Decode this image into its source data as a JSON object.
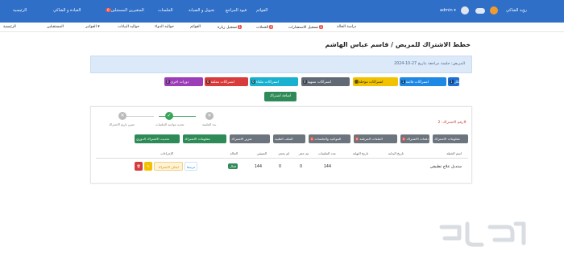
{
  "topbar": {
    "home": "الرئيسية",
    "clinic": "العيادة و الشاكي",
    "doctors": "المتغيرين المسجلين",
    "sessions": "الجلسات",
    "doctors_badge": "0",
    "followup": "تحويل و الصيانة",
    "employees": "قيود المراجع",
    "reports": "القوائم",
    "admin": "admin",
    "user_name": "رؤية الشاكي"
  },
  "subnav": {
    "items": [
      "الرئيسية",
      "المستقبلين",
      "الفواتير",
      "حواليه البيانات",
      "حواليه الدواء",
      "القوائم",
      "تسجيل زيارة",
      "الحملات",
      "تسجيل الاستشارات",
      "دراسة الحالة"
    ],
    "badges": [
      "1",
      "4",
      "1"
    ]
  },
  "page": {
    "title": "خطط الاشتراك للمريض / قاسم عباس الهاشم",
    "alert": "المريض: جلسة مراجعة بتاريخ 27-10-2024"
  },
  "chips": [
    {
      "label": "الكل",
      "n": "1",
      "color": "#1d6fd1"
    },
    {
      "label": "اشتراكات قائمة",
      "n": "1",
      "color": "#1e88e5"
    },
    {
      "label": "اشتراكات مؤجلة",
      "n": "0",
      "color": "#f2c200"
    },
    {
      "label": "اشتراكات منتهية",
      "n": "0",
      "color": "#616975"
    },
    {
      "label": "اشتراكات ملغاة",
      "n": "0",
      "color": "#18b1cf"
    },
    {
      "label": "اشتراكات معلقة",
      "n": "0",
      "color": "#d73b3b"
    },
    {
      "label": "دورات اخرى",
      "n": "0",
      "color": "#9c3eb7"
    }
  ],
  "add_button": "اضافة اشتراك",
  "card": {
    "title": "رقم الاشتراك: 2#",
    "steps": [
      {
        "label": "تعيين تاريخ الاشتراك"
      },
      {
        "label": "تحديد مواعيد الجلسات"
      },
      {
        "label": "بدء الجلسة"
      }
    ],
    "tabs": [
      {
        "label": "تحديث الاشتراك الدوري",
        "n": ""
      },
      {
        "label": "معلومات الاشتراك",
        "n": "",
        "green": true
      },
      {
        "label": "تقرير الاشتراك",
        "n": ""
      },
      {
        "label": "الملف الطبية",
        "n": ""
      },
      {
        "label": "المواعيد والجلسات",
        "n": "0"
      },
      {
        "label": "الملفات المرفقة",
        "n": "0"
      },
      {
        "label": "دفعات الاشتراك",
        "n": "0"
      },
      {
        "label": "معلومات الاشتراك",
        "n": ""
      }
    ],
    "headers": [
      "اسم الخطة",
      "تاريخ البداية",
      "تاريخ النهاية",
      "عدد الجلسات",
      "تم حجز",
      "لم يحجز",
      "المتبقي",
      "الحالة",
      "الإجراءات"
    ],
    "row": {
      "plan": "ستديل علاج تطبيقي",
      "start": "",
      "end": "",
      "sessions": "144",
      "booked": "0",
      "not_booked": "0",
      "remaining": "144",
      "status": "فعال",
      "action_edit": "مرتبط",
      "action_main": "ايقاف الاشتراك"
    }
  }
}
